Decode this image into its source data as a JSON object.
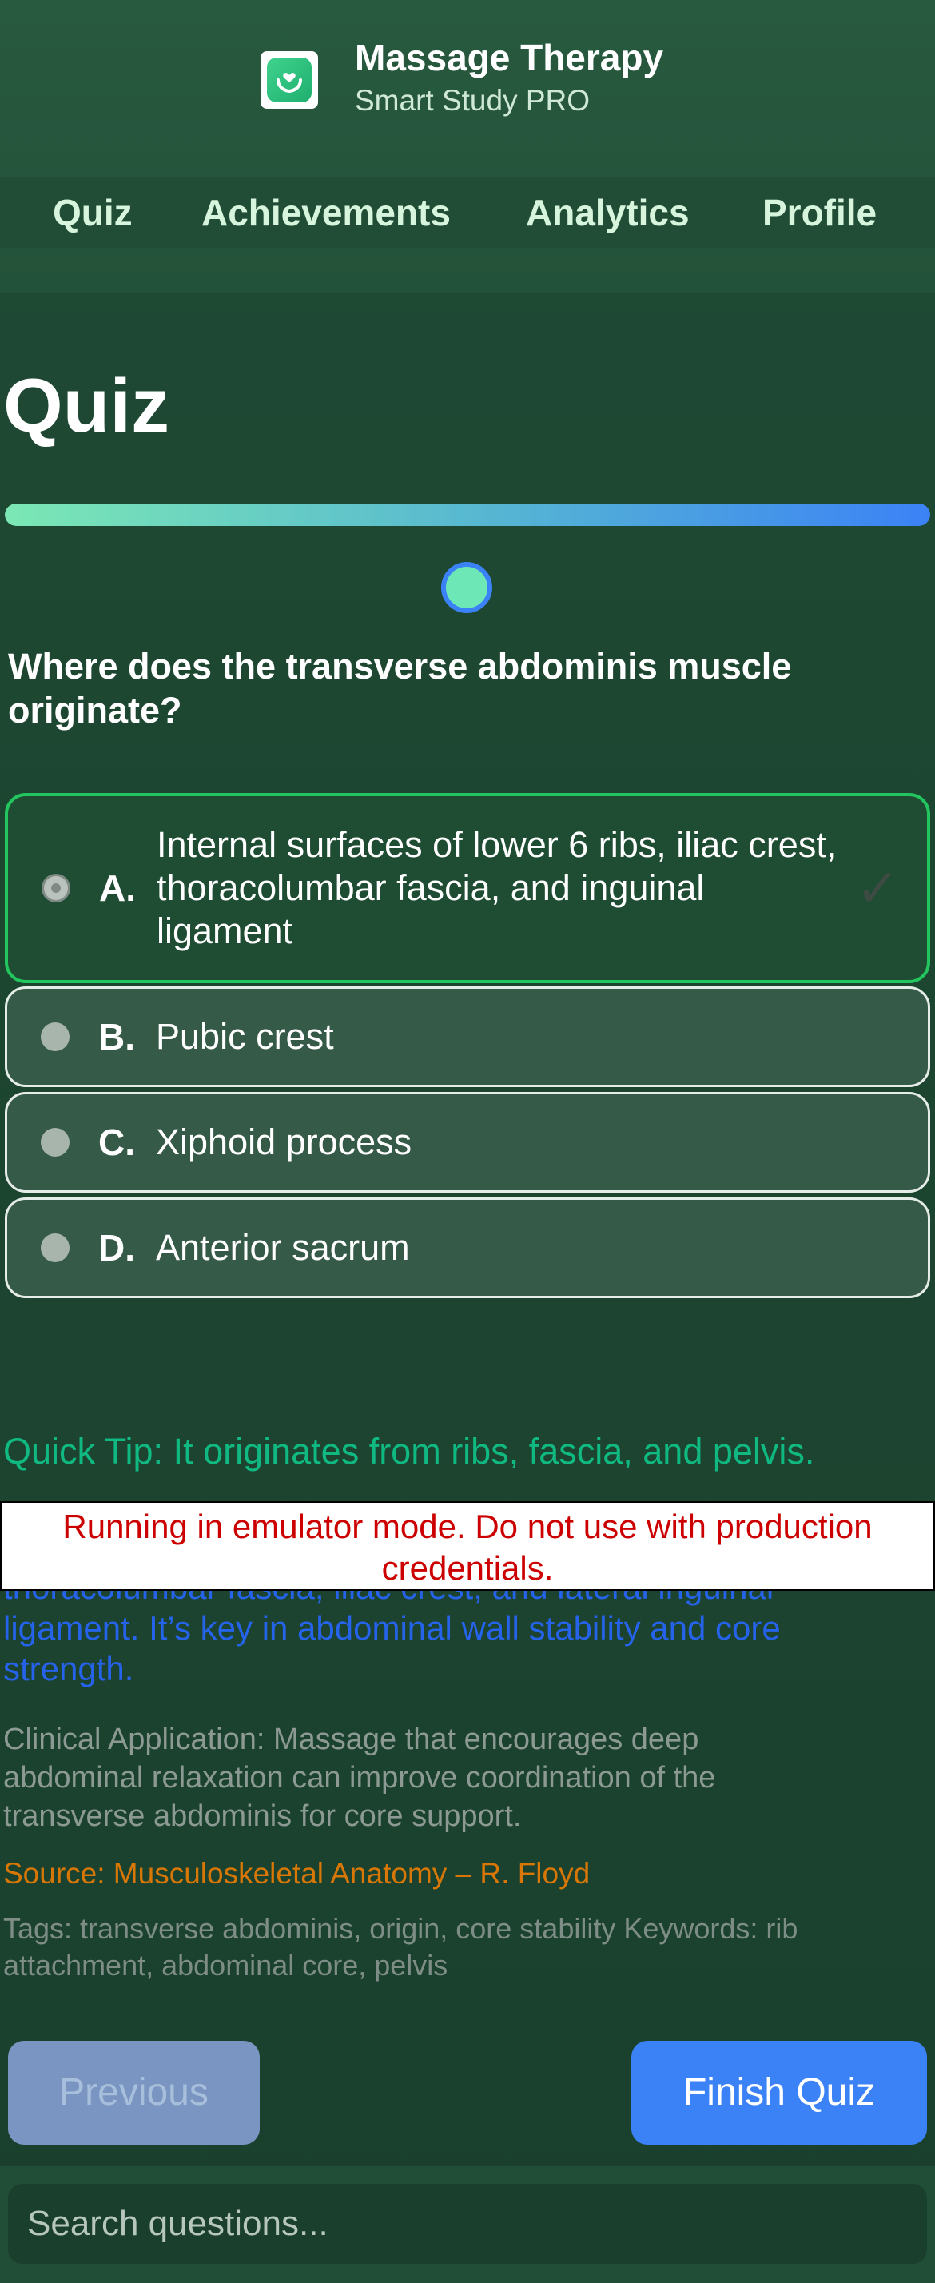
{
  "app": {
    "title": "Massage Therapy",
    "subtitle": "Smart Study PRO",
    "logo_icon": "hands-heart-icon"
  },
  "nav": {
    "items": [
      {
        "label": "Quiz"
      },
      {
        "label": "Achievements"
      },
      {
        "label": "Analytics"
      },
      {
        "label": "Profile"
      }
    ]
  },
  "page": {
    "title": "Quiz",
    "progress_fraction": 1.0
  },
  "question": {
    "text": "Where does the transverse abdominis muscle originate?",
    "options": [
      {
        "letter": "A.",
        "text": "Internal surfaces of lower 6 ribs, iliac crest, thoracolumbar fascia, and inguinal ligament",
        "selected": true
      },
      {
        "letter": "B.",
        "text": "Pubic crest",
        "selected": false
      },
      {
        "letter": "C.",
        "text": "Xiphoid process",
        "selected": false
      },
      {
        "letter": "D.",
        "text": "Anterior sacrum",
        "selected": false
      }
    ],
    "check_glyph": "✓"
  },
  "feedback": {
    "tip": "Quick Tip: It originates from ribs, fascia, and pelvis.",
    "explanation": "thoracolumbar fascia, iliac crest, and lateral inguinal ligament. It’s key in abdominal wall stability and core strength.",
    "clinical": "Clinical Application: Massage that encourages deep abdominal relaxation can improve coordination of the transverse abdominis for core support.",
    "source": "Source: Musculoskeletal Anatomy – R. Floyd",
    "tags": "Tags: transverse abdominis, origin, core stability Keywords: rib attachment, abdominal core, pelvis"
  },
  "banner": {
    "text": "Running in emulator mode. Do not use with production credentials."
  },
  "buttons": {
    "previous": "Previous",
    "finish": "Finish Quiz"
  },
  "search": {
    "placeholder": "Search questions..."
  },
  "colors": {
    "accent": "#3b82f6",
    "correct": "#22c55e",
    "tip": "#10b981",
    "source": "#d97706",
    "banner_text": "#cc0000"
  }
}
